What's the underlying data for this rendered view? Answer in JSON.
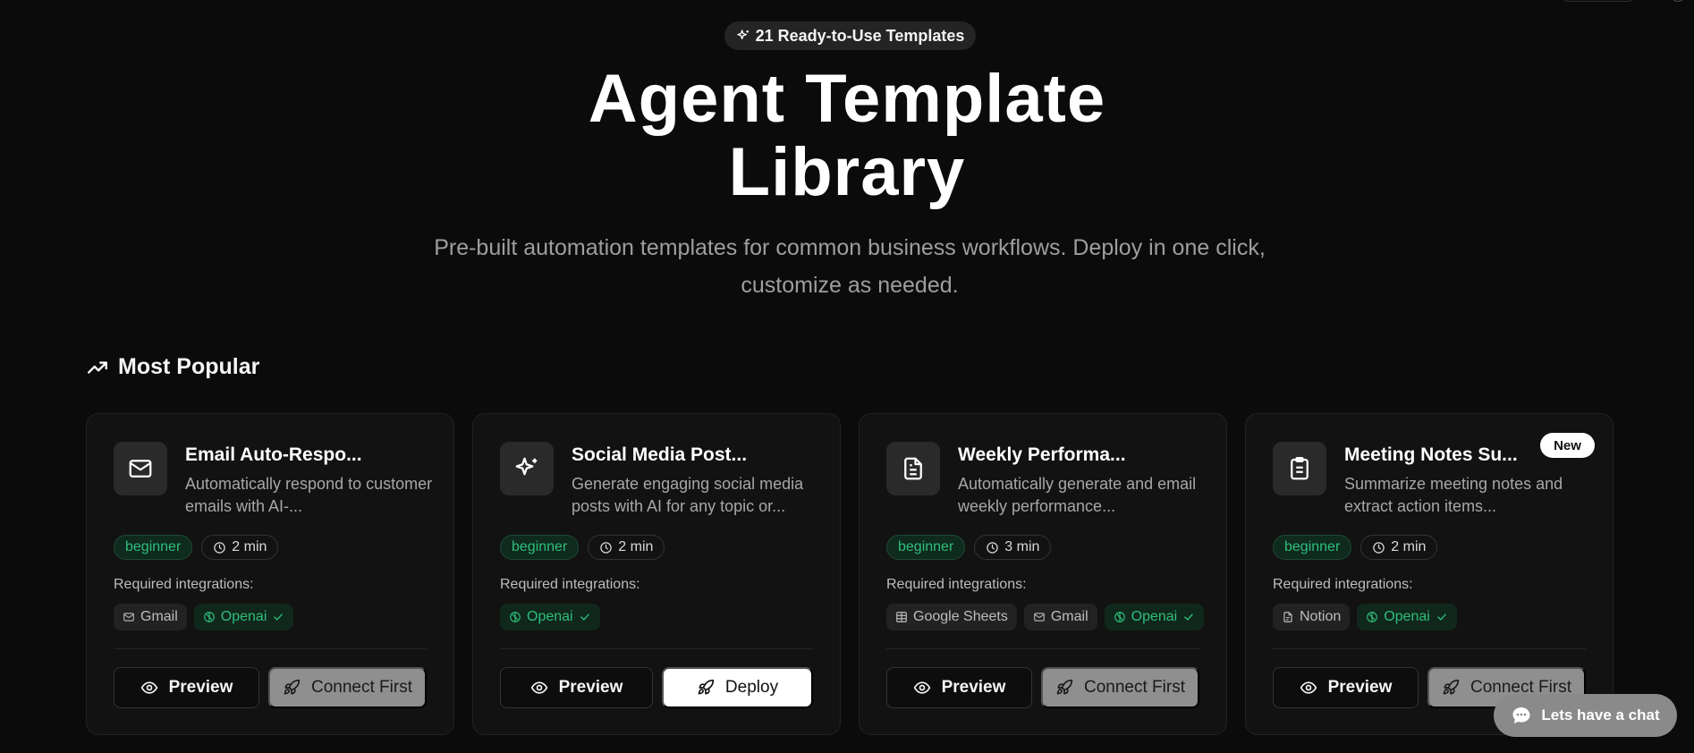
{
  "hero": {
    "badge": "21 Ready-to-Use Templates",
    "title_line1": "Agent Template",
    "title_line2": "Library",
    "subtitle": "Pre-built automation templates for common business workflows. Deploy in one click, customize as needed."
  },
  "section": {
    "title": "Most Popular",
    "icon": "trending-up-icon"
  },
  "labels": {
    "required": "Required integrations:",
    "preview": "Preview",
    "connect": "Connect First",
    "deploy": "Deploy",
    "new": "New"
  },
  "cards": [
    {
      "icon": "mail-icon",
      "title": "Email Auto-Respo...",
      "desc": "Automatically respond to customer emails with AI-...",
      "level": "beginner",
      "time": "2 min",
      "integrations": [
        {
          "name": "Gmail",
          "icon": "mail-icon",
          "connected": false
        },
        {
          "name": "Openai",
          "icon": "openai-icon",
          "connected": true
        }
      ],
      "action": "Connect First"
    },
    {
      "icon": "sparkles-icon",
      "title": "Social Media Post...",
      "desc": "Generate engaging social media posts with AI for any topic or...",
      "level": "beginner",
      "time": "2 min",
      "integrations": [
        {
          "name": "Openai",
          "icon": "openai-icon",
          "connected": true
        }
      ],
      "action": "Deploy"
    },
    {
      "icon": "document-icon",
      "title": "Weekly Performa...",
      "desc": "Automatically generate and email weekly performance...",
      "level": "beginner",
      "time": "3 min",
      "integrations": [
        {
          "name": "Google Sheets",
          "icon": "table-icon",
          "connected": false
        },
        {
          "name": "Gmail",
          "icon": "mail-icon",
          "connected": false
        },
        {
          "name": "Openai",
          "icon": "openai-icon",
          "connected": true
        }
      ],
      "action": "Connect First"
    },
    {
      "icon": "clipboard-icon",
      "title": "Meeting Notes Su...",
      "desc": "Summarize meeting notes and extract action items...",
      "level": "beginner",
      "time": "2 min",
      "integrations": [
        {
          "name": "Notion",
          "icon": "file-icon",
          "connected": false
        },
        {
          "name": "Openai",
          "icon": "openai-icon",
          "connected": true
        }
      ],
      "action": "Connect First",
      "is_new": true
    }
  ],
  "chat": {
    "label": "Lets have a chat"
  },
  "colors": {
    "background": "#0b0b0b",
    "card": "#121212",
    "accent_green": "#2fbf7a",
    "connect_button": "#8f8f8f"
  }
}
